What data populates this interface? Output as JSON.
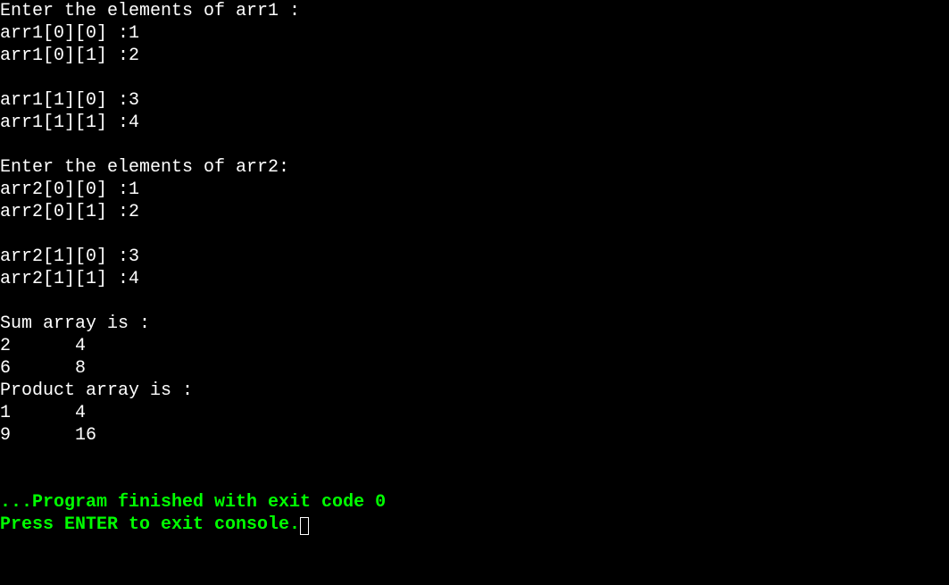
{
  "console": {
    "lines": [
      {
        "text": "Enter the elements of arr1 :",
        "color": "white"
      },
      {
        "text": "arr1[0][0] :1",
        "color": "white"
      },
      {
        "text": "arr1[0][1] :2",
        "color": "white"
      },
      {
        "text": "",
        "color": "white"
      },
      {
        "text": "arr1[1][0] :3",
        "color": "white"
      },
      {
        "text": "arr1[1][1] :4",
        "color": "white"
      },
      {
        "text": "",
        "color": "white"
      },
      {
        "text": "Enter the elements of arr2:",
        "color": "white"
      },
      {
        "text": "arr2[0][0] :1",
        "color": "white"
      },
      {
        "text": "arr2[0][1] :2",
        "color": "white"
      },
      {
        "text": "",
        "color": "white"
      },
      {
        "text": "arr2[1][0] :3",
        "color": "white"
      },
      {
        "text": "arr2[1][1] :4",
        "color": "white"
      },
      {
        "text": "",
        "color": "white"
      },
      {
        "text": "Sum array is :",
        "color": "white"
      },
      {
        "text": "2      4",
        "color": "white"
      },
      {
        "text": "6      8",
        "color": "white"
      },
      {
        "text": "Product array is :",
        "color": "white"
      },
      {
        "text": "1      4",
        "color": "white"
      },
      {
        "text": "9      16",
        "color": "white"
      },
      {
        "text": "",
        "color": "white"
      },
      {
        "text": "",
        "color": "white"
      },
      {
        "text": "...Program finished with exit code 0",
        "color": "green"
      },
      {
        "text": "Press ENTER to exit console.",
        "color": "green",
        "cursor": true
      }
    ]
  },
  "program_data": {
    "arr1": [
      [
        1,
        2
      ],
      [
        3,
        4
      ]
    ],
    "arr2": [
      [
        1,
        2
      ],
      [
        3,
        4
      ]
    ],
    "sum": [
      [
        2,
        4
      ],
      [
        6,
        8
      ]
    ],
    "product": [
      [
        1,
        4
      ],
      [
        9,
        16
      ]
    ],
    "exit_code": 0
  }
}
